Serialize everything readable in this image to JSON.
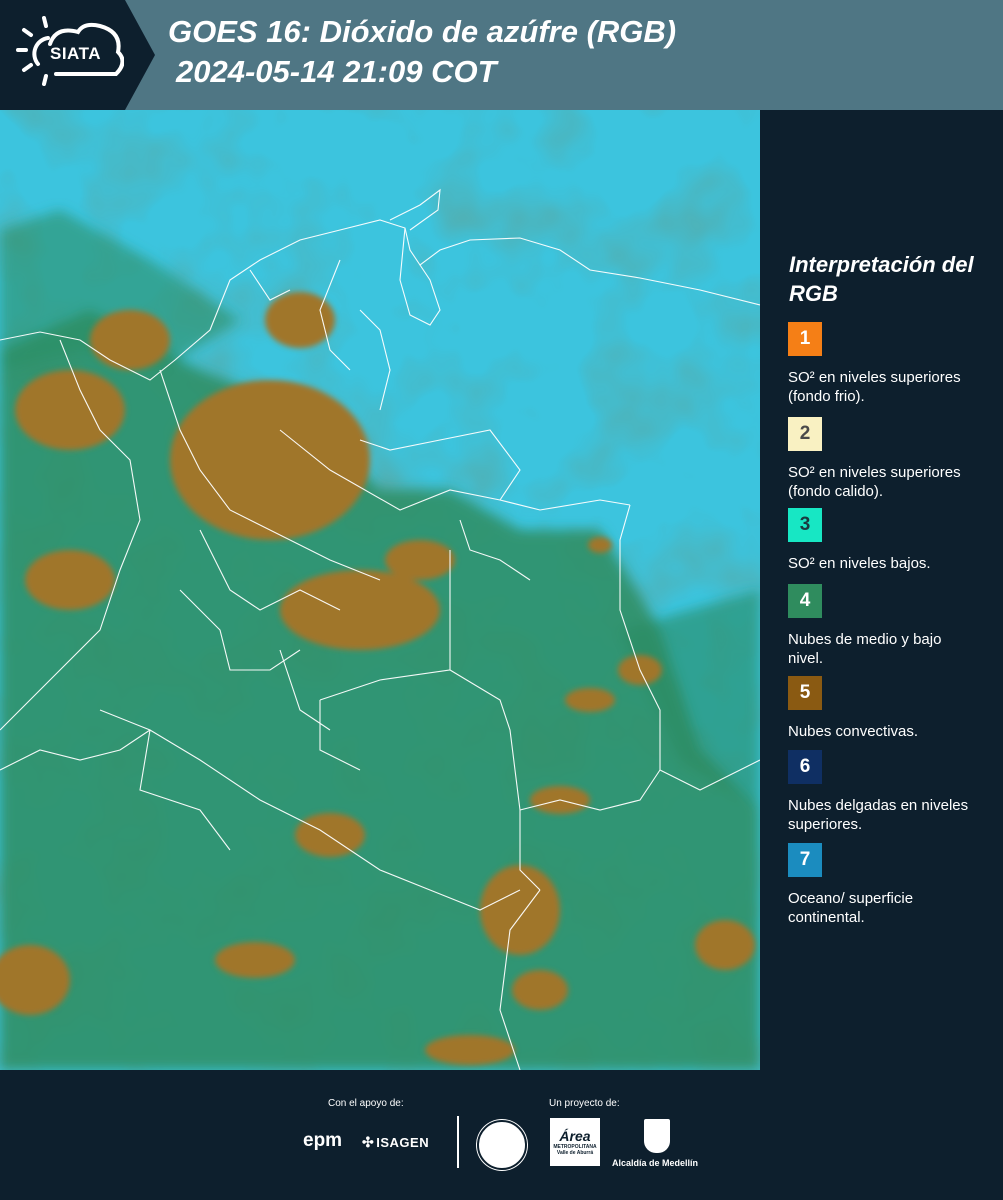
{
  "header": {
    "logo_text": "SIATA",
    "title_line1": "GOES 16: Dióxido de azúfre (RGB)",
    "title_line2": "2024-05-14 21:09 COT"
  },
  "legend": {
    "title": "Interpretación del RGB",
    "items": [
      {
        "number": "1",
        "color": "#f57f16",
        "text_color": "#ffffff",
        "text": "SO² en niveles superiores (fondo frio)."
      },
      {
        "number": "2",
        "color": "#f9f1c2",
        "text_color": "#4a4a4a",
        "text": "SO² en niveles superiores (fondo calido)."
      },
      {
        "number": "3",
        "color": "#17e7c4",
        "text_color": "#1a3a40",
        "text": "SO² en niveles bajos."
      },
      {
        "number": "4",
        "color": "#2f8c5e",
        "text_color": "#ffffff",
        "text": "Nubes de medio y bajo nivel."
      },
      {
        "number": "5",
        "color": "#8a5a12",
        "text_color": "#ffffff",
        "text": "Nubes convectivas."
      },
      {
        "number": "6",
        "color": "#0f2f63",
        "text_color": "#ffffff",
        "text": "Nubes delgadas en niveles superiores."
      },
      {
        "number": "7",
        "color": "#1b8cbf",
        "text_color": "#ffffff",
        "text": "Oceano/ superficie continental."
      }
    ]
  },
  "colors": {
    "header_bg": "#4f7684",
    "dark_bg": "#0d1f2d",
    "map_ocean": "#3cc4de",
    "map_green": "#2d8d62",
    "map_convective": "#a0762c",
    "border_lines": "#ffffff"
  },
  "footer": {
    "support_label": "Con el apoyo de:",
    "project_label": "Un proyecto de:",
    "sponsor_1": "epm",
    "sponsor_2": "ISAGEN",
    "partner_area": "Área",
    "partner_area_sub": "METROPOLITANA Valle de Aburrá",
    "partner_alcaldia": "Alcaldía de Medellín"
  }
}
